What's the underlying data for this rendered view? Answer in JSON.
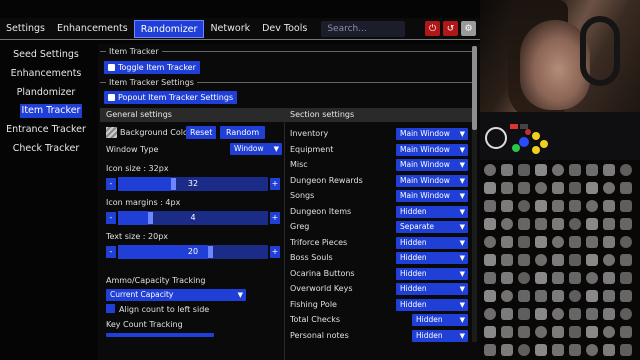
{
  "menubar": {
    "items": [
      "Settings",
      "Enhancements",
      "Randomizer",
      "Network",
      "Dev Tools"
    ],
    "active_index": 2,
    "search_placeholder": "Search...",
    "power_icon": "power-icon",
    "reset_icon": "reset-icon",
    "gear_icon": "gear-icon"
  },
  "sidebar": {
    "items": [
      "Seed Settings",
      "Enhancements",
      "Plandomizer",
      "Item Tracker",
      "Entrance Tracker",
      "Check Tracker"
    ],
    "active_index": 3
  },
  "main": {
    "item_tracker_header": "Item Tracker",
    "toggle_button": "Toggle Item Tracker",
    "settings_header": "Item Tracker Settings",
    "popout_button": "Popout Item Tracker Settings",
    "general_settings": "General settings",
    "section_settings": "Section settings",
    "background_color_label": "Background Color",
    "reset_button": "Reset",
    "random_button": "Random",
    "window_type_label": "Window Type",
    "window_type_value": "Window",
    "icon_size_label": "Icon size : 32px",
    "icon_size_value": "32",
    "icon_size_fraction": 0.35,
    "icon_margins_label": "Icon margins : 4px",
    "icon_margins_value": "4",
    "icon_margins_fraction": 0.2,
    "text_size_label": "Text size : 20px",
    "text_size_value": "20",
    "text_size_fraction": 0.6,
    "ammo_label": "Ammo/Capacity Tracking",
    "ammo_value": "Current Capacity",
    "align_count_label": "Align count to left side",
    "key_count_label": "Key Count Tracking",
    "minus": "-",
    "plus": "+"
  },
  "sections": [
    {
      "label": "Inventory",
      "value": "Main Window"
    },
    {
      "label": "Equipment",
      "value": "Main Window"
    },
    {
      "label": "Misc",
      "value": "Main Window"
    },
    {
      "label": "Dungeon Rewards",
      "value": "Main Window"
    },
    {
      "label": "Songs",
      "value": "Main Window"
    },
    {
      "label": "Dungeon Items",
      "value": "Hidden"
    },
    {
      "label": "Greg",
      "value": "Separate"
    },
    {
      "label": "Triforce Pieces",
      "value": "Hidden"
    },
    {
      "label": "Boss Souls",
      "value": "Hidden"
    },
    {
      "label": "Ocarina Buttons",
      "value": "Hidden"
    },
    {
      "label": "Overworld Keys",
      "value": "Hidden"
    },
    {
      "label": "Fishing Pole",
      "value": "Hidden"
    },
    {
      "label": "Total Checks",
      "value": "Hidden"
    },
    {
      "label": "Personal notes",
      "value": "Hidden"
    }
  ],
  "colors": {
    "accent": "#1f3fd6",
    "danger": "#b01818"
  }
}
